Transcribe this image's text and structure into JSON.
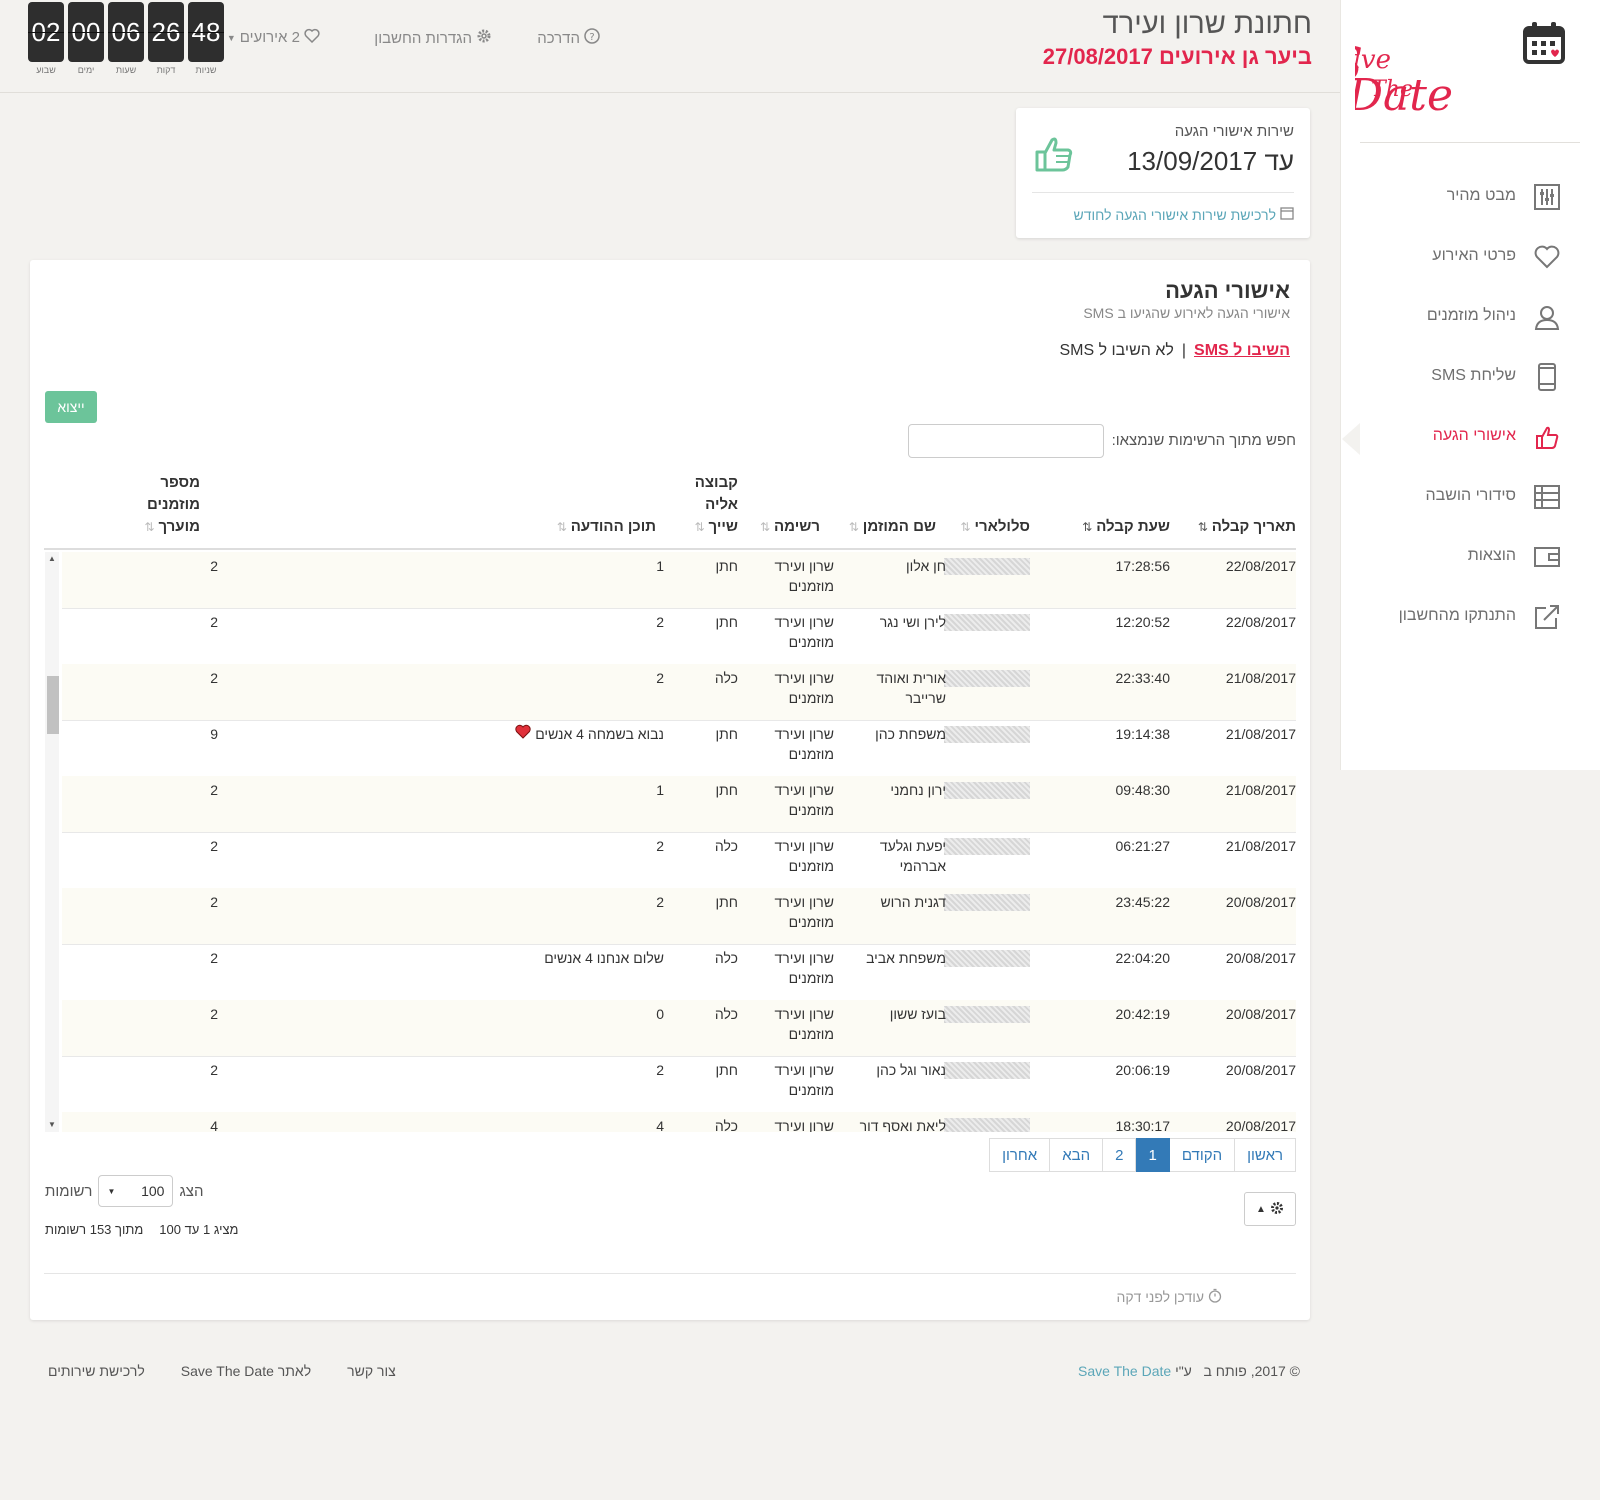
{
  "logo": {
    "line1": "Save",
    "line2": "The",
    "line3": "Date"
  },
  "sidebar": {
    "items": [
      {
        "label": "מבט מהיר",
        "icon": "sliders-icon"
      },
      {
        "label": "פרטי האירוע",
        "icon": "heart-icon"
      },
      {
        "label": "ניהול מוזמנים",
        "icon": "user-icon"
      },
      {
        "label": "שליחת SMS",
        "icon": "mobile-icon"
      },
      {
        "label": "אישורי הגעה",
        "icon": "thumbs-up-icon",
        "active": true
      },
      {
        "label": "סידורי הושבה",
        "icon": "list-icon"
      },
      {
        "label": "הוצאות",
        "icon": "wallet-icon"
      },
      {
        "label": "התנתקו מהחשבון",
        "icon": "external-link-icon"
      }
    ]
  },
  "header": {
    "title": "חתונת שרון ועירד",
    "subtitle": "ביער גן אירועים 27/08/2017",
    "help": "הדרכה",
    "settings": "הגדרות החשבון",
    "events": "2 אירועים"
  },
  "countdown": [
    {
      "value": "02",
      "label": "שבוע"
    },
    {
      "value": "00",
      "label": "ימים"
    },
    {
      "value": "06",
      "label": "שעות"
    },
    {
      "value": "26",
      "label": "דקות"
    },
    {
      "value": "48",
      "label": "שניות"
    }
  ],
  "service": {
    "title": "שירות אישורי הגעה",
    "until": "עד 13/09/2017",
    "link": "לרכישת שירות אישורי הגעה לחודש"
  },
  "panel": {
    "title": "אישורי הגעה",
    "subtitle": "אישורי הגעה לאירוע שהגיעו ב SMS",
    "filter_active": "השיבו ל SMS",
    "filter_sep": "|",
    "filter_other": "לא השיבו ל SMS",
    "export": "ייצוא",
    "search_label": "חפש מתוך הרשימות שנמצאו:",
    "search_value": ""
  },
  "table": {
    "headers": {
      "date": "תאריך קבלה",
      "time": "שעת קבלה",
      "phone": "סלולארי",
      "name": "שם המוזמן",
      "list": "רשימה",
      "group": "קבוצה אליה שייך",
      "message": "תוכן ההודעה",
      "guests": "מספר מוזמנים מוערך"
    },
    "rows": [
      {
        "date": "22/08/2017",
        "time": "17:28:56",
        "name": "חן אלון",
        "list": "שרון ועירד מוזמנים",
        "group": "חתן",
        "message": "1",
        "guests": "2"
      },
      {
        "date": "22/08/2017",
        "time": "12:20:52",
        "name": "לירן ושי נגר",
        "list": "שרון ועירד מוזמנים",
        "group": "חתן",
        "message": "2",
        "guests": "2"
      },
      {
        "date": "21/08/2017",
        "time": "22:33:40",
        "name": "אורית ואוהד שרייבר",
        "list": "שרון ועירד מוזמנים",
        "group": "כלה",
        "message": "2",
        "guests": "2"
      },
      {
        "date": "21/08/2017",
        "time": "19:14:38",
        "name": "משפחת כהן",
        "list": "שרון ועירד מוזמנים",
        "group": "חתן",
        "message": "נבוא בשמחה 4 אנשים",
        "guests": "9",
        "heart": true
      },
      {
        "date": "21/08/2017",
        "time": "09:48:30",
        "name": "ירון נחמני",
        "list": "שרון ועירד מוזמנים",
        "group": "חתן",
        "message": "1",
        "guests": "2"
      },
      {
        "date": "21/08/2017",
        "time": "06:21:27",
        "name": "יפעת וגלעד אברהמי",
        "list": "שרון ועירד מוזמנים",
        "group": "כלה",
        "message": "2",
        "guests": "2"
      },
      {
        "date": "20/08/2017",
        "time": "23:45:22",
        "name": "דגנית הרוש",
        "list": "שרון ועירד מוזמנים",
        "group": "חתן",
        "message": "2",
        "guests": "2"
      },
      {
        "date": "20/08/2017",
        "time": "22:04:20",
        "name": "משפחת אביב",
        "list": "שרון ועירד מוזמנים",
        "group": "כלה",
        "message": "שלום אנחנו 4 אנשים",
        "guests": "2"
      },
      {
        "date": "20/08/2017",
        "time": "20:42:19",
        "name": "בועז ששון",
        "list": "שרון ועירד מוזמנים",
        "group": "כלה",
        "message": "0",
        "guests": "2"
      },
      {
        "date": "20/08/2017",
        "time": "20:06:19",
        "name": "נאור וגל כהן",
        "list": "שרון ועירד מוזמנים",
        "group": "חתן",
        "message": "2",
        "guests": "2"
      },
      {
        "date": "20/08/2017",
        "time": "18:30:17",
        "name": "ליאת ואסף דור",
        "list": "שרון ועירד מוזמנים",
        "group": "כלה",
        "message": "4",
        "guests": "4"
      }
    ]
  },
  "pager": {
    "first": "ראשון",
    "prev": "הקודם",
    "p1": "1",
    "p2": "2",
    "next": "הבא",
    "last": "אחרון"
  },
  "page_size": {
    "show": "הצג",
    "value": "100",
    "records": "רשומות"
  },
  "info": {
    "range": "מציג 1 עד 100",
    "total": "מתוך 153 רשומות"
  },
  "updated": "עודכן לפני דקה",
  "footer": {
    "copy_prefix": "© 2017, פותח ב",
    "copy_mid": "ע\"י",
    "brand": "Save The Date",
    "contact": "צור קשר",
    "site": "לאתר Save The Date",
    "buy": "לרכישת שירותים"
  },
  "colors": {
    "brand": "#e2264d",
    "accent": "#5ba6b8",
    "export": "#6cc49a",
    "pager": "#337ab7"
  }
}
